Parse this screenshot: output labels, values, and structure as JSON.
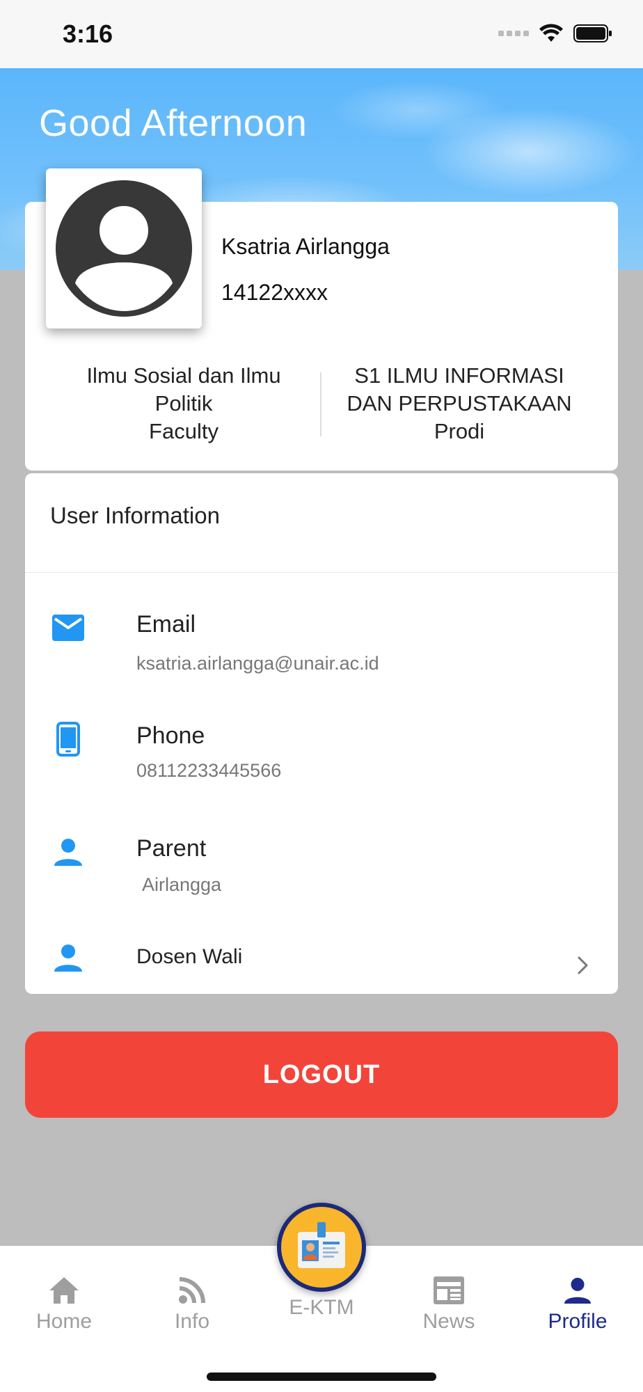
{
  "status_bar": {
    "time": "3:16"
  },
  "header": {
    "greeting": "Good Afternoon"
  },
  "profile": {
    "name": "Ksatria Airlangga",
    "id": "14122xxxx",
    "faculty_value": "Ilmu Sosial dan Ilmu Politik",
    "faculty_label": "Faculty",
    "prodi_value": "S1 ILMU INFORMASI DAN PERPUSTAKAAN",
    "prodi_label": "Prodi"
  },
  "user_info": {
    "title": "User Information",
    "email_label": "Email",
    "email_value": "ksatria.airlangga@unair.ac.id",
    "phone_label": "Phone",
    "phone_value": "08112233445566",
    "parent_label": "Parent",
    "parent_value": "Airlangga",
    "dosen_label": "Dosen Wali"
  },
  "logout_label": "LOGOUT",
  "nav": {
    "home": "Home",
    "info": "Info",
    "ektm": "E-KTM",
    "news": "News",
    "profile": "Profile"
  },
  "colors": {
    "accent_blue": "#2196f3",
    "logout_red": "#f3443a",
    "active_nav": "#1e2a8c"
  }
}
